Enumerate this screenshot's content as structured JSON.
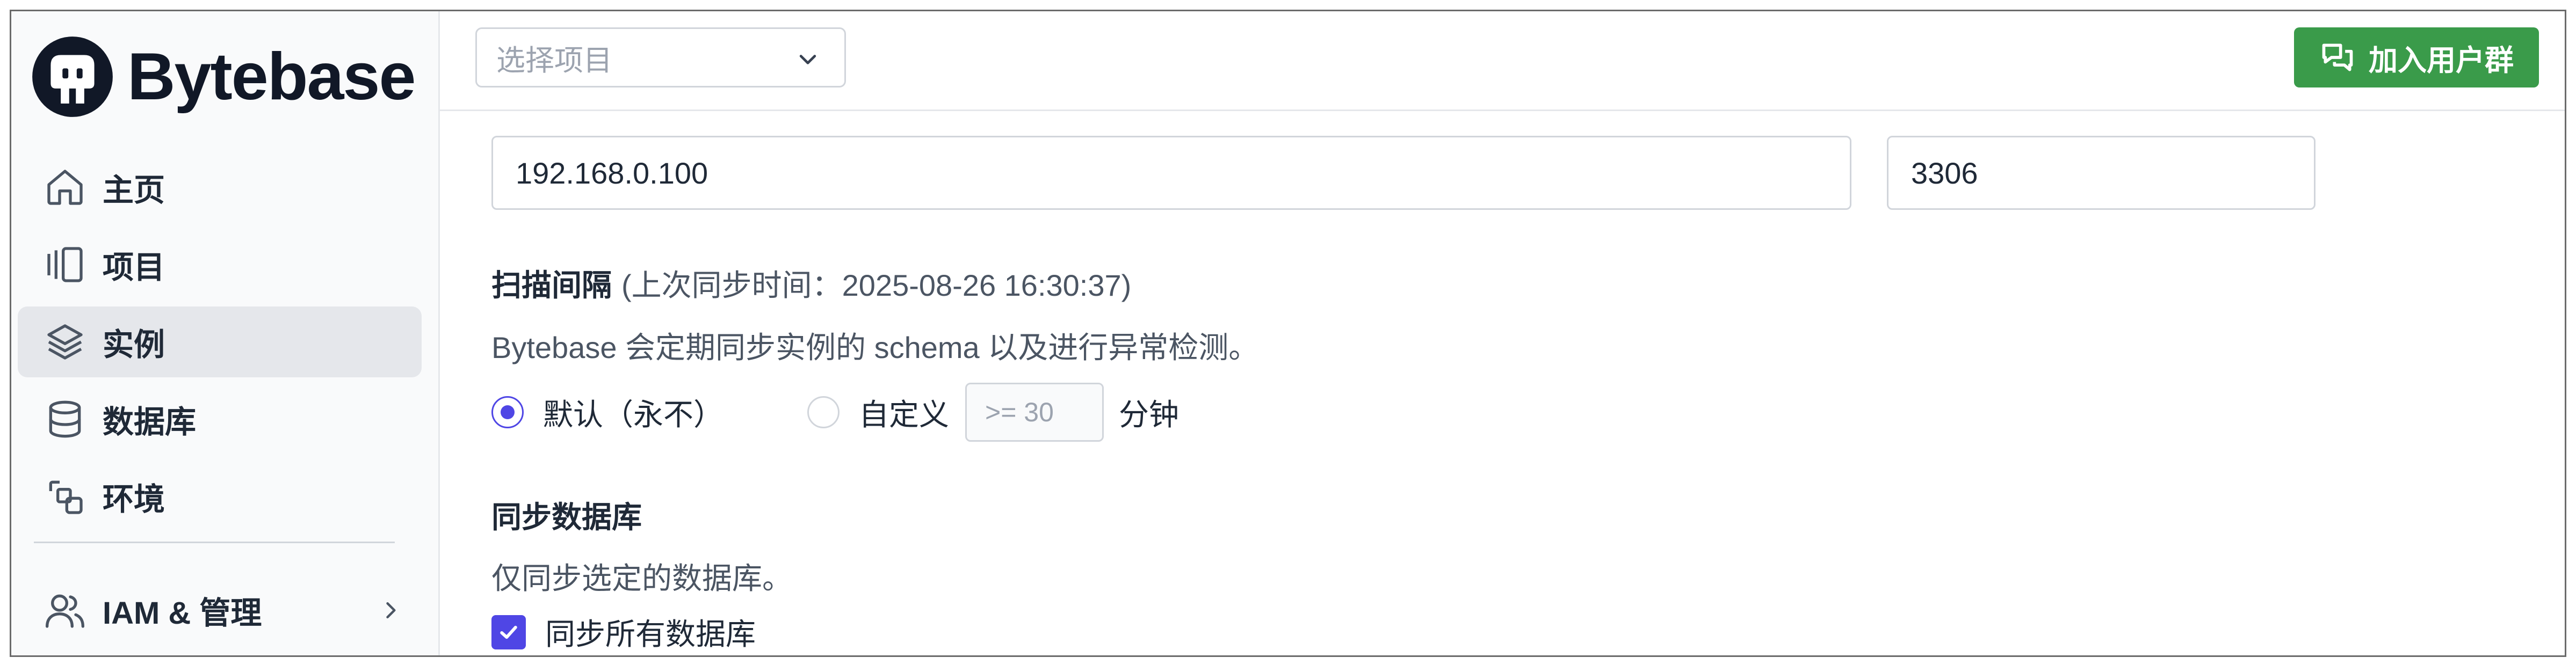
{
  "app": {
    "brand": "Bytebase"
  },
  "sidebar": {
    "items": [
      {
        "label": "主页",
        "icon": "home-icon"
      },
      {
        "label": "项目",
        "icon": "project-icon"
      },
      {
        "label": "实例",
        "icon": "layers-icon",
        "active": true
      },
      {
        "label": "数据库",
        "icon": "database-icon"
      },
      {
        "label": "环境",
        "icon": "environment-icon"
      },
      {
        "label": "IAM & 管理",
        "icon": "users-icon",
        "has_chevron": true
      }
    ]
  },
  "header": {
    "project_select_placeholder": "选择项目",
    "join_button_label": "加入用户群"
  },
  "connection": {
    "host": "192.168.0.100",
    "port": "3306"
  },
  "scan_interval": {
    "title": "扫描间隔",
    "last_sync": "(上次同步时间：2025-08-26 16:30:37)",
    "description": "Bytebase 会定期同步实例的 schema 以及进行异常检测。",
    "option_default": "默认（永不）",
    "option_custom": "自定义",
    "custom_placeholder": ">= 30",
    "unit": "分钟",
    "selected": "default"
  },
  "sync_databases": {
    "title": "同步数据库",
    "description": "仅同步选定的数据库。",
    "sync_all_label": "同步所有数据库",
    "sync_all_checked": true
  },
  "colors": {
    "accent": "#4f46e5",
    "join_button": "#3a9b4a",
    "active_nav_bg": "#e5e7eb"
  }
}
